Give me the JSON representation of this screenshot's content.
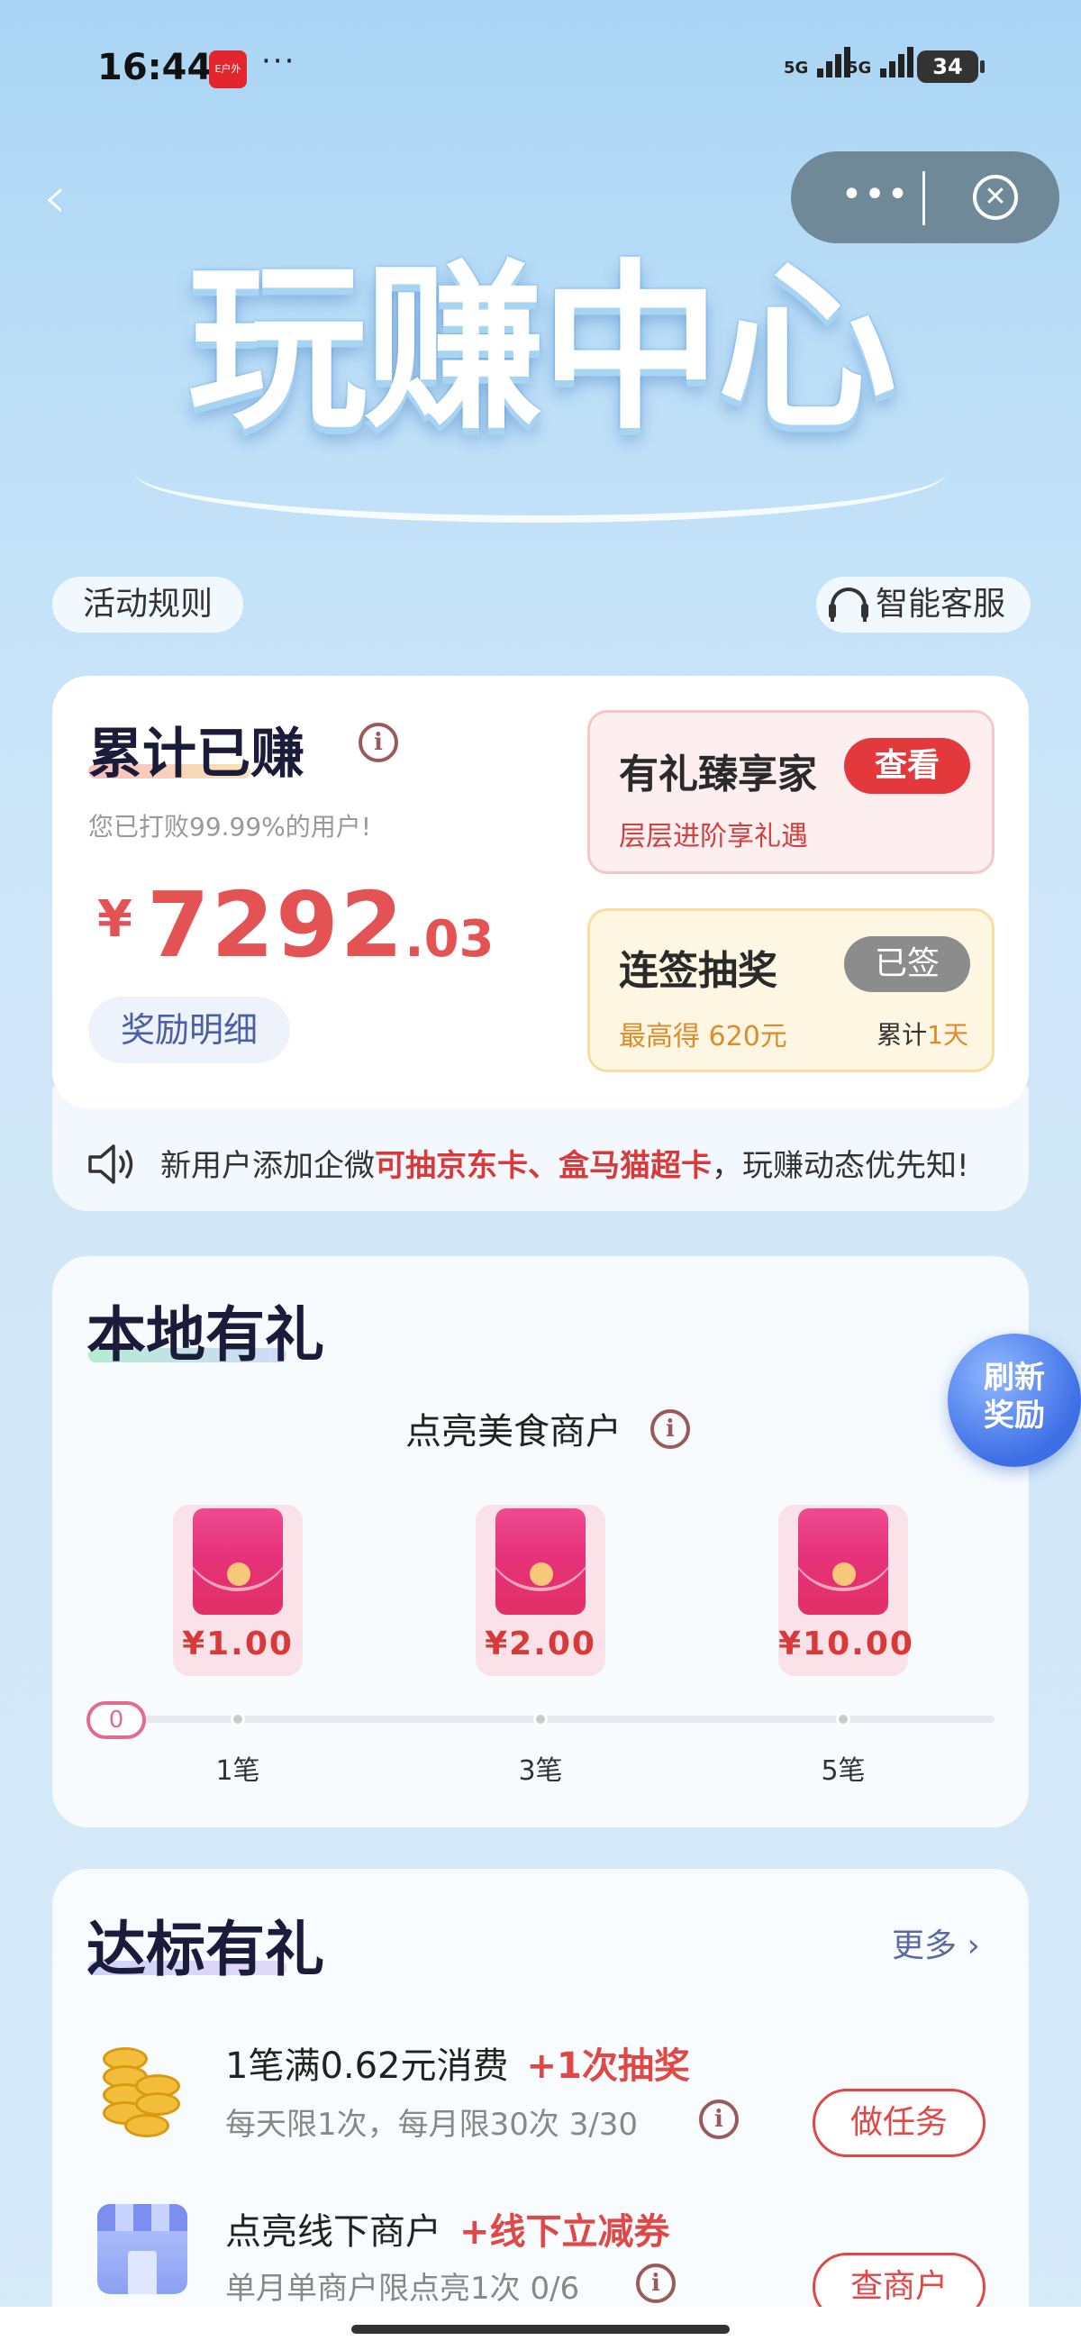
{
  "status_bar": {
    "time": "16:44",
    "app_badge": "E户外",
    "dots": "···",
    "signal_1": "5G",
    "signal_2": "5G",
    "battery": "34"
  },
  "nav": {
    "menu_dots": "•••",
    "close_glyph": "✕"
  },
  "hero": {
    "title": "玩赚中心"
  },
  "top_links": {
    "rules": "活动规则",
    "service": "智能客服"
  },
  "earnings": {
    "title": "累计已赚",
    "subtitle": "您已打败99.99%的用户!",
    "currency": "¥",
    "amount_int": "7292",
    "amount_dec": ".03",
    "detail_button": "奖励明细"
  },
  "vip": {
    "title": "有礼臻享家",
    "button": "查看",
    "subtitle": "层层进阶享礼遇"
  },
  "sign_in": {
    "title": "连签抽奖",
    "button": "已签",
    "max_prefix": "最高得",
    "max_value": "620元",
    "days_prefix": "累计",
    "days_value": "1天"
  },
  "notice": {
    "part1": "新用户添加企微",
    "highlight": "可抽京东卡、盒马猫超卡",
    "part2": "，玩赚动态优先知!"
  },
  "local_gifts": {
    "title": "本地有礼",
    "refresh_line1": "刷新",
    "refresh_line2": "奖励",
    "subtitle": "点亮美食商户",
    "rewards": [
      {
        "value": "¥1.00",
        "step": "1笔"
      },
      {
        "value": "¥2.00",
        "step": "3笔"
      },
      {
        "value": "¥10.00",
        "step": "5笔"
      }
    ],
    "progress": "0"
  },
  "target_gifts": {
    "title": "达标有礼",
    "more": "更多 ›",
    "tasks": [
      {
        "title": "1笔满0.62元消费",
        "bonus": "+1次抽奖",
        "sub": "每天限1次，每月限30次  3/30",
        "button": "做任务"
      },
      {
        "title": "点亮线下商户",
        "bonus": "+线下立减券",
        "sub": "单月单商户限点亮1次  0/6",
        "button": "查商户"
      }
    ]
  },
  "colors": {
    "accent_red": "#e04848",
    "brand_blue": "#3e6ee6",
    "background": "#cfe6f8"
  }
}
